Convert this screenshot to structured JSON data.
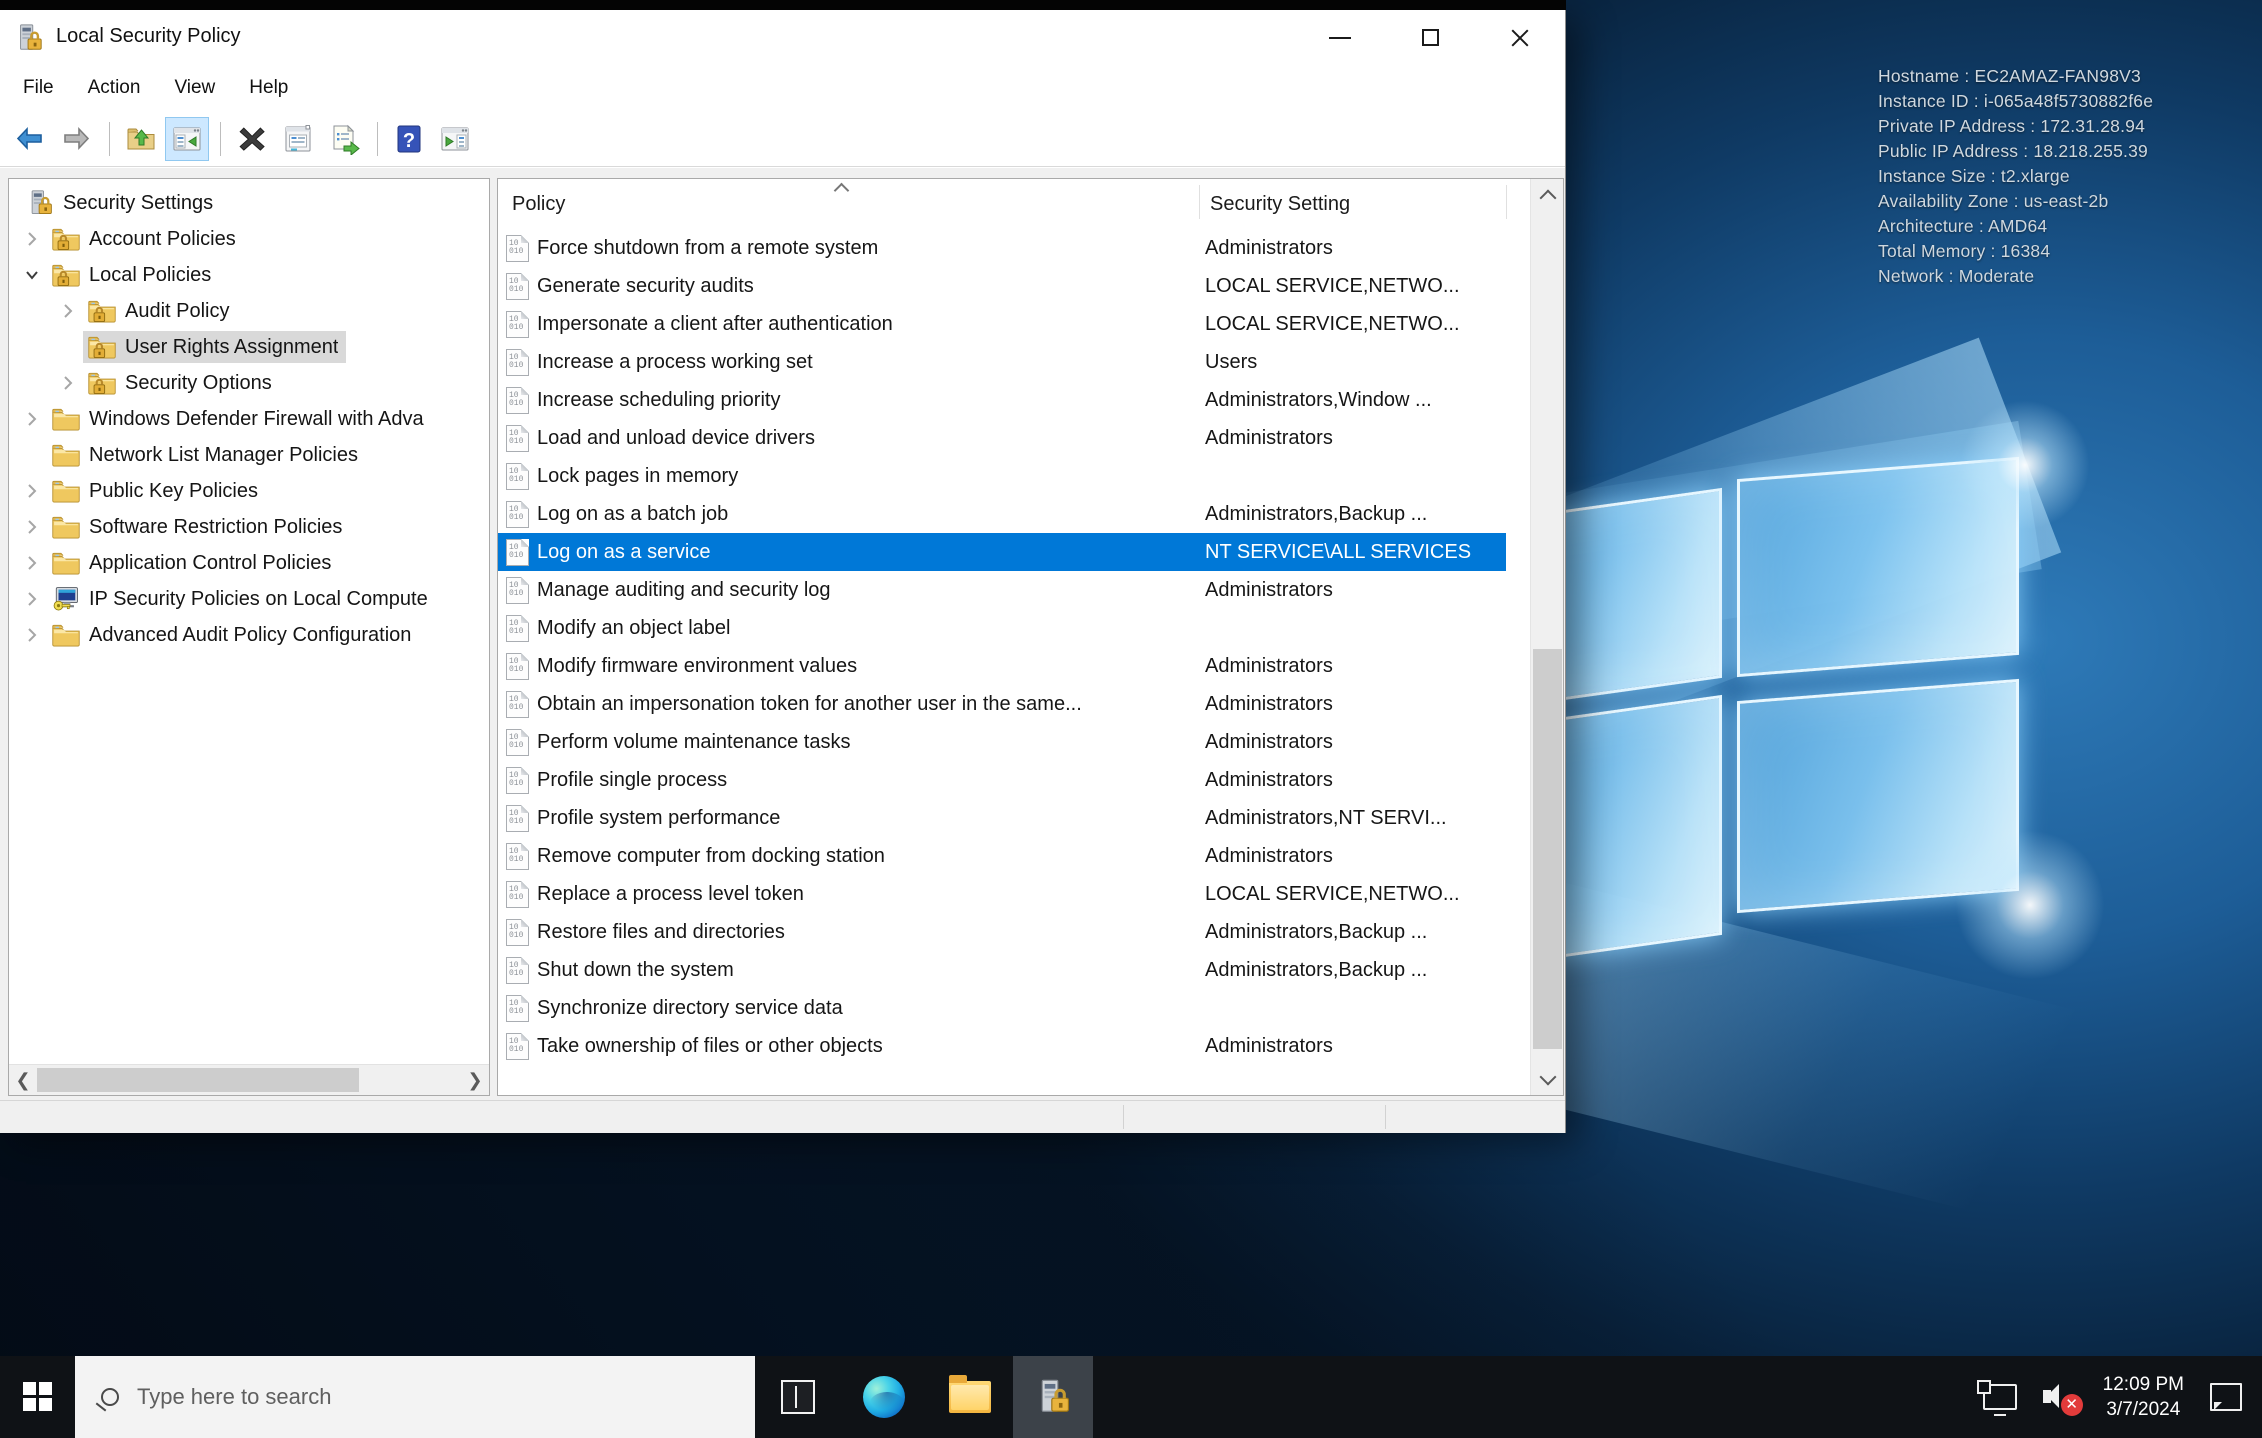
{
  "window": {
    "title": "Local Security Policy",
    "menu_items": [
      "File",
      "Action",
      "View",
      "Help"
    ],
    "toolbar": [
      {
        "icon": "arrow-back",
        "name": "back-button"
      },
      {
        "icon": "arrow-forward",
        "name": "forward-button"
      },
      {
        "sep": true
      },
      {
        "icon": "folder-up",
        "name": "up-one-level-button"
      },
      {
        "icon": "console-tree",
        "name": "show-console-tree-button",
        "active": true
      },
      {
        "sep": true
      },
      {
        "icon": "delete-x",
        "name": "delete-button"
      },
      {
        "icon": "properties",
        "name": "properties-button"
      },
      {
        "icon": "export-list",
        "name": "export-list-button"
      },
      {
        "sep": true
      },
      {
        "icon": "help",
        "name": "help-button"
      },
      {
        "icon": "action-pane",
        "name": "show-action-pane-button"
      }
    ],
    "controls": {
      "minimize": "minimize",
      "maximize": "maximize",
      "close": "close"
    }
  },
  "tree": {
    "items": [
      {
        "label": "Security Settings",
        "level": 0,
        "expander": "none",
        "icon": "server-lock-icon",
        "selected": false
      },
      {
        "label": "Account Policies",
        "level": 1,
        "expander": "collapsed",
        "icon": "folder-lock-icon",
        "selected": false
      },
      {
        "label": "Local Policies",
        "level": 1,
        "expander": "expanded",
        "icon": "folder-lock-icon",
        "selected": false
      },
      {
        "label": "Audit Policy",
        "level": 2,
        "expander": "collapsed",
        "icon": "folder-lock-icon",
        "selected": false
      },
      {
        "label": "User Rights Assignment",
        "level": 2,
        "expander": "none",
        "icon": "folder-lock-icon",
        "selected": true
      },
      {
        "label": "Security Options",
        "level": 2,
        "expander": "collapsed",
        "icon": "folder-lock-icon",
        "selected": false
      },
      {
        "label": "Windows Defender Firewall with Adva",
        "level": 1,
        "expander": "collapsed",
        "icon": "folder-icon",
        "selected": false
      },
      {
        "label": "Network List Manager Policies",
        "level": 1,
        "expander": "none",
        "icon": "folder-icon",
        "selected": false
      },
      {
        "label": "Public Key Policies",
        "level": 1,
        "expander": "collapsed",
        "icon": "folder-icon",
        "selected": false
      },
      {
        "label": "Software Restriction Policies",
        "level": 1,
        "expander": "collapsed",
        "icon": "folder-icon",
        "selected": false
      },
      {
        "label": "Application Control Policies",
        "level": 1,
        "expander": "collapsed",
        "icon": "folder-icon",
        "selected": false
      },
      {
        "label": "IP Security Policies on Local Compute",
        "level": 1,
        "expander": "collapsed",
        "icon": "computer-key-icon",
        "selected": false
      },
      {
        "label": "Advanced Audit Policy Configuration",
        "level": 1,
        "expander": "collapsed",
        "icon": "folder-icon",
        "selected": false
      }
    ]
  },
  "list": {
    "columns": [
      "Policy",
      "Security Setting"
    ],
    "rows": [
      {
        "policy": "Force shutdown from a remote system",
        "setting": "Administrators",
        "selected": false
      },
      {
        "policy": "Generate security audits",
        "setting": "LOCAL SERVICE,NETWO...",
        "selected": false
      },
      {
        "policy": "Impersonate a client after authentication",
        "setting": "LOCAL SERVICE,NETWO...",
        "selected": false
      },
      {
        "policy": "Increase a process working set",
        "setting": "Users",
        "selected": false
      },
      {
        "policy": "Increase scheduling priority",
        "setting": "Administrators,Window ...",
        "selected": false
      },
      {
        "policy": "Load and unload device drivers",
        "setting": "Administrators",
        "selected": false
      },
      {
        "policy": "Lock pages in memory",
        "setting": "",
        "selected": false
      },
      {
        "policy": "Log on as a batch job",
        "setting": "Administrators,Backup ...",
        "selected": false
      },
      {
        "policy": "Log on as a service",
        "setting": "NT SERVICE\\ALL SERVICES",
        "selected": true
      },
      {
        "policy": "Manage auditing and security log",
        "setting": "Administrators",
        "selected": false
      },
      {
        "policy": "Modify an object label",
        "setting": "",
        "selected": false
      },
      {
        "policy": "Modify firmware environment values",
        "setting": "Administrators",
        "selected": false
      },
      {
        "policy": "Obtain an impersonation token for another user in the same...",
        "setting": "Administrators",
        "selected": false
      },
      {
        "policy": "Perform volume maintenance tasks",
        "setting": "Administrators",
        "selected": false
      },
      {
        "policy": "Profile single process",
        "setting": "Administrators",
        "selected": false
      },
      {
        "policy": "Profile system performance",
        "setting": "Administrators,NT SERVI...",
        "selected": false
      },
      {
        "policy": "Remove computer from docking station",
        "setting": "Administrators",
        "selected": false
      },
      {
        "policy": "Replace a process level token",
        "setting": "LOCAL SERVICE,NETWO...",
        "selected": false
      },
      {
        "policy": "Restore files and directories",
        "setting": "Administrators,Backup ...",
        "selected": false
      },
      {
        "policy": "Shut down the system",
        "setting": "Administrators,Backup ...",
        "selected": false
      },
      {
        "policy": "Synchronize directory service data",
        "setting": "",
        "selected": false
      },
      {
        "policy": "Take ownership of files or other objects",
        "setting": "Administrators",
        "selected": false
      }
    ]
  },
  "desktop": {
    "ec2_info_lines": [
      "Hostname : EC2AMAZ-FAN98V3",
      "Instance ID : i-065a48f5730882f6e",
      "Private IP Address : 172.31.28.94",
      "Public IP Address : 18.218.255.39",
      "Instance Size : t2.xlarge",
      "Availability Zone : us-east-2b",
      "Architecture : AMD64",
      "Total Memory : 16384",
      "Network : Moderate"
    ]
  },
  "taskbar": {
    "search_placeholder": "Type here to search",
    "clock": {
      "time": "12:09 PM",
      "date": "3/7/2024"
    }
  },
  "colors": {
    "selection_blue": "#0078d7",
    "tree_selection_gray": "#d9d9d9",
    "toolbar_active_bg": "#cde8ff",
    "taskbar_bg": "#0f1216",
    "mute_badge_red": "#e23b3b"
  }
}
